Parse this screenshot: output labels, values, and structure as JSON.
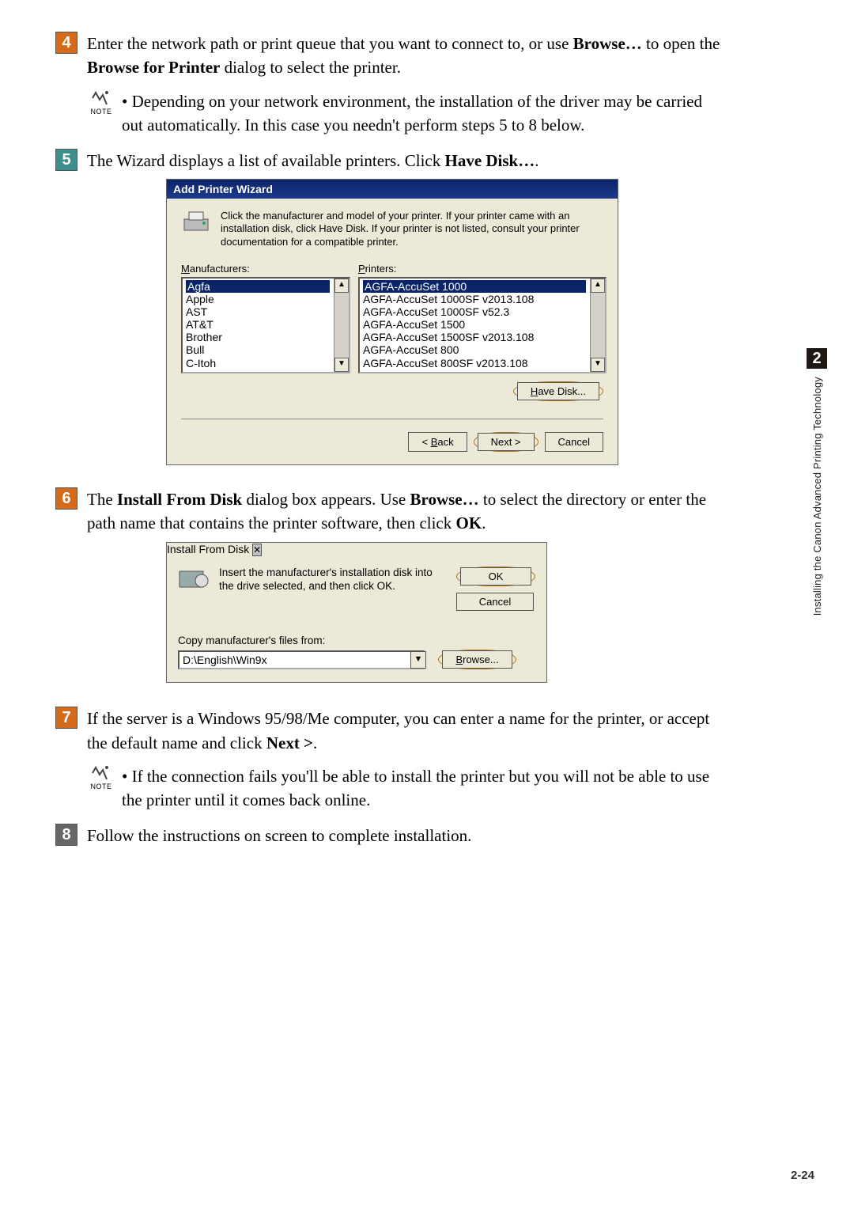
{
  "steps": {
    "s4": {
      "num": "4",
      "text_a": "Enter the network path or print queue that you want to connect to, or use ",
      "browse": "Browse…",
      "text_b": " to open the ",
      "bfp": "Browse for Printer",
      "text_c": " dialog to select the printer."
    },
    "s5": {
      "num": "5",
      "text_a": "The Wizard displays a list of available printers. Click ",
      "hd": "Have Disk…",
      "text_b": "."
    },
    "s6": {
      "num": "6",
      "text_a": "The ",
      "ifd": "Install From Disk",
      "text_b": " dialog box appears. Use ",
      "browse": "Browse…",
      "text_c": " to select the directory or enter the path name that contains the printer software, then click ",
      "ok": "OK",
      "text_d": "."
    },
    "s7": {
      "num": "7",
      "text_a": "If the server is a Windows 95/98/Me computer, you can enter a name for the printer, or accept the default name and click ",
      "next": "Next >",
      "text_b": "."
    },
    "s8": {
      "num": "8",
      "text": "Follow the instructions on screen to complete installation."
    }
  },
  "notes": {
    "n1": "Depending on your network environment, the installation of the driver may be carried out automatically. In this case you needn't perform steps 5 to 8 below.",
    "n2": "If the connection fails you'll be able to install the printer but you will not be able to use the printer until it comes back online.",
    "label": "NOTE"
  },
  "wizard": {
    "title": "Add Printer Wizard",
    "top_text": "Click the manufacturer and model of your printer. If your printer came with an installation disk, click Have Disk. If your printer is not listed, consult your printer documentation for a compatible printer.",
    "manuf_label_a": "M",
    "manuf_label_b": "anufacturers:",
    "printers_label_a": "P",
    "printers_label_b": "rinters:",
    "manufacturers": [
      "Agfa",
      "Apple",
      "AST",
      "AT&T",
      "Brother",
      "Bull",
      "C-Itoh"
    ],
    "printers": [
      "AGFA-AccuSet 1000",
      "AGFA-AccuSet 1000SF v2013.108",
      "AGFA-AccuSet 1000SF v52.3",
      "AGFA-AccuSet 1500",
      "AGFA-AccuSet 1500SF v2013.108",
      "AGFA-AccuSet 800",
      "AGFA-AccuSet 800SF v2013.108"
    ],
    "have_disk_a": "H",
    "have_disk_b": "ave Disk...",
    "back_a": "< ",
    "back_u": "B",
    "back_b": "ack",
    "next": "Next >",
    "cancel": "Cancel"
  },
  "install_disk": {
    "title": "Install From Disk",
    "text": "Insert the manufacturer's installation disk into the drive selected, and then click OK.",
    "ok": "OK",
    "cancel": "Cancel",
    "copy_label": "Copy manufacturer's files from:",
    "path": "D:\\English\\Win9x",
    "browse_a": "B",
    "browse_b": "rowse..."
  },
  "rail": {
    "tab": "2",
    "text": "Installing the Canon Advanced Printing Technology"
  },
  "page_num": "2-24"
}
